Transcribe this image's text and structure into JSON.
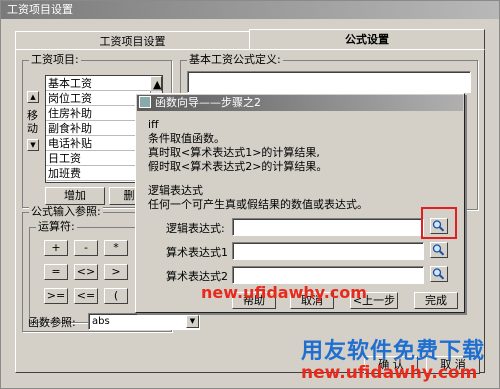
{
  "window": {
    "title": "工资项目设置"
  },
  "tabs": [
    {
      "label": "工资项目设置"
    },
    {
      "label": "公式设置"
    }
  ],
  "salary_items": {
    "group_label": "工资项目:",
    "items": [
      "基本工资",
      "岗位工资",
      "住房补助",
      "副食补助",
      "电话补贴",
      "日工资",
      "加班费"
    ],
    "move_label": "移动",
    "add_button": "增加",
    "delete_button": "删"
  },
  "formula_definition": {
    "group_label": "基本工资公式定义:"
  },
  "formula_input": {
    "group_label": "公式输入参照:",
    "operators_label": "运算符:",
    "operators": [
      "+",
      "-",
      "*",
      "=",
      "<>",
      ">",
      ">=",
      "<=",
      "("
    ]
  },
  "function_reference": {
    "label": "函数参照:",
    "value": "abs"
  },
  "main_buttons": {
    "ok": "确 认",
    "cancel": "取 消"
  },
  "dialog": {
    "title": "函数向导——步骤之2",
    "func_name": "iff",
    "description_lines": [
      "条件取值函数。",
      "真时取<算术表达式1>的计算结果,",
      "假时取<算术表达式2>的计算结果。"
    ],
    "section_title": "逻辑表达式",
    "section_desc": "任何一个可产生真或假结果的数值或表达式。",
    "fields": [
      {
        "label": "逻辑表达式:",
        "value": ""
      },
      {
        "label": "算术表达式1",
        "value": ""
      },
      {
        "label": "算术表达式2",
        "value": ""
      }
    ],
    "buttons": {
      "help": "帮助",
      "cancel": "取消",
      "prev": "<上一步",
      "finish": "完成"
    }
  },
  "watermarks": {
    "url1": "new.ufidawhy.com",
    "brand": "用友软件免费下载",
    "url2": "new.ufidawhy.com"
  },
  "colors": {
    "highlight": "#e02020",
    "watermark_red": "#e8291c",
    "watermark_blue": "#1f6fd1"
  }
}
